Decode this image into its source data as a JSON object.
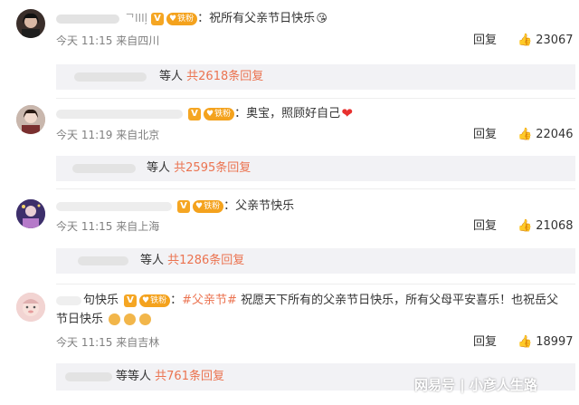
{
  "comments": [
    {
      "name_partial": "ᄀIIIļ",
      "text": "祝所有父亲节日快乐",
      "emoji": "😘",
      "time": "今天 11:15",
      "location": "来自四川",
      "reply_label": "回复",
      "likes": "23067",
      "sub": {
        "ppl": "等人",
        "total": "共2618条回复"
      },
      "avatar_color": "#3a2e2a"
    },
    {
      "name_partial": "",
      "text": "奥宝，照顾好自己",
      "emoji": "❤",
      "time": "今天 11:19",
      "location": "来自北京",
      "reply_label": "回复",
      "likes": "22046",
      "sub": {
        "ppl": "等人",
        "total": "共2595条回复"
      },
      "avatar_color": "#b9a79a"
    },
    {
      "name_partial": "",
      "text": "父亲节快乐",
      "emoji": "",
      "time": "今天 11:15",
      "location": "来自上海",
      "reply_label": "回复",
      "likes": "21068",
      "sub": {
        "ppl": "等人",
        "total": "共1286条回复"
      },
      "avatar_color": "#5a4d8a"
    },
    {
      "name_partial": "句快乐",
      "hashtag": "#父亲节#",
      "text": "祝愿天下所有的父亲节日快乐，所有父母平安喜乐！也祝岳父",
      "text2": "节日快乐",
      "emoji": "",
      "time": "今天 11:15",
      "location": "来自吉林",
      "reply_label": "回复",
      "likes": "18997",
      "sub": {
        "ppl": "等等人",
        "total": "共761条回复"
      },
      "avatar_color": "#e7c3c0"
    }
  ],
  "badge": {
    "v": "V",
    "fan": "铁粉",
    "fan_heart": "♥"
  },
  "colon": "：",
  "watermark": "网易号 | 小彦人生路"
}
